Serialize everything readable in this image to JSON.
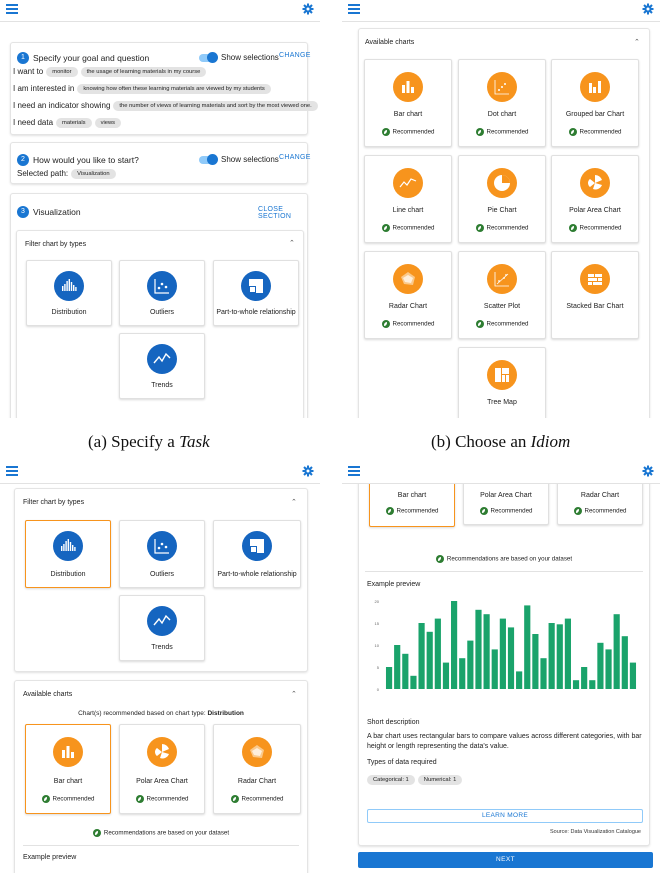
{
  "captions": {
    "a_prefix": "(a) Specify a ",
    "a_em": "Task",
    "b_prefix": "(b) Choose an ",
    "b_em": "Idiom"
  },
  "colors": {
    "primary": "#1976d2",
    "chart_icon_blue": "#1565c0",
    "chart_icon_orange": "#f7941d",
    "bar_green": "#1aa36b",
    "rec_green": "#2e7d32"
  },
  "icons": {
    "menu": "hamburger-menu-icon",
    "settings": "gear-icon"
  },
  "panel_a": {
    "step1": {
      "number": "1",
      "title": "Specify your goal and question",
      "toggle_label": "Show selections",
      "action": "CHANGE",
      "rows": [
        {
          "label": "I want to",
          "chips": [
            "monitor",
            "the usage of learning materials in my course"
          ]
        },
        {
          "label": "I am interested in",
          "chips": [
            "knowing how often these learning materials are viewed by my students"
          ]
        },
        {
          "label": "I need an indicator showing",
          "chips": [
            "the number of views of learning materials and sort by the most viewed one."
          ]
        },
        {
          "label": "I need data",
          "chips": [
            "materials",
            "views"
          ]
        }
      ]
    },
    "step2": {
      "number": "2",
      "title": "How would you like to start?",
      "toggle_label": "Show selections",
      "action": "CHANGE",
      "selected_path_label": "Selected path:",
      "selected_path_chip": "Visualization"
    },
    "step3": {
      "number": "3",
      "title": "Visualization",
      "action": "CLOSE SECTION",
      "filter_title": "Filter chart by types",
      "types": [
        "Distribution",
        "Outliers",
        "Part-to-whole relationship",
        "Trends"
      ]
    }
  },
  "panel_b": {
    "title": "Available charts",
    "recommended_label": "Recommended",
    "charts": [
      {
        "name": "Bar chart",
        "recommended": true
      },
      {
        "name": "Dot chart",
        "recommended": true
      },
      {
        "name": "Grouped bar Chart",
        "recommended": true
      },
      {
        "name": "Line chart",
        "recommended": true
      },
      {
        "name": "Pie Chart",
        "recommended": true
      },
      {
        "name": "Polar Area Chart",
        "recommended": true
      },
      {
        "name": "Radar Chart",
        "recommended": true
      },
      {
        "name": "Scatter Plot",
        "recommended": true
      },
      {
        "name": "Stacked Bar Chart",
        "recommended": false
      },
      {
        "name": "Tree Map",
        "recommended": false
      }
    ]
  },
  "panel_c": {
    "filter_title": "Filter chart by types",
    "types": [
      "Distribution",
      "Outliers",
      "Part-to-whole relationship",
      "Trends"
    ],
    "available_title": "Available charts",
    "recommend_note_prefix": "Chart(s) recommended based on chart type: ",
    "recommend_note_type": "Distribution",
    "charts": [
      "Bar chart",
      "Polar Area Chart",
      "Radar Chart"
    ],
    "recommended_label": "Recommended",
    "dataset_note": "Recommendations are based on your dataset",
    "preview_title": "Example preview"
  },
  "panel_d": {
    "charts": [
      "Bar chart",
      "Polar Area Chart",
      "Radar Chart"
    ],
    "recommended_label": "Recommended",
    "dataset_note": "Recommendations are based on your dataset",
    "preview_title": "Example preview",
    "short_desc_title": "Short description",
    "short_desc": "A bar chart uses rectangular bars to compare values across different categories, with bar height or length representing the data's value.",
    "types_title": "Types of data required",
    "type_chips": [
      "Categorical: 1",
      "Numerical: 1"
    ],
    "learn_more": "LEARN MORE",
    "source": "Source: Data Visualization Catalogue",
    "next": "NEXT"
  },
  "chart_data": {
    "type": "bar",
    "title": "",
    "xlabel": "",
    "ylabel": "",
    "ylim": [
      0,
      20
    ],
    "yticks": [
      "20",
      "15",
      "10",
      "5",
      "0"
    ],
    "values": [
      5,
      10,
      8,
      3,
      15,
      13,
      16,
      6,
      20,
      7,
      11,
      18,
      17,
      9,
      16,
      14,
      4,
      19,
      12.5,
      7,
      15,
      14.7,
      16,
      2,
      5,
      2,
      10.5,
      9,
      17,
      12,
      6
    ]
  }
}
